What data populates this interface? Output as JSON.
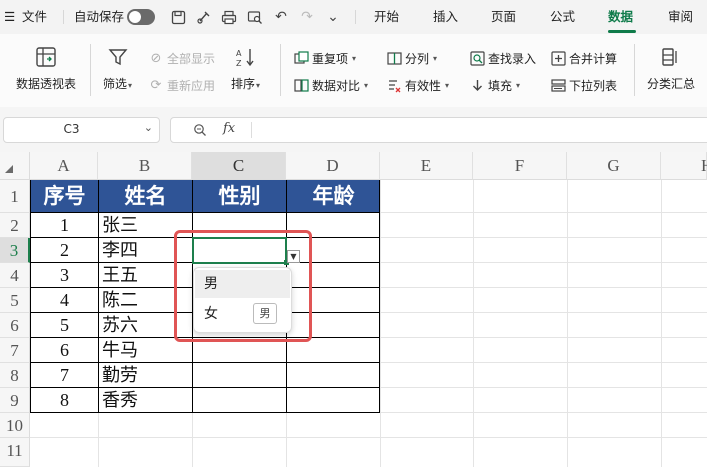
{
  "menubar": {
    "menu_icon": "hamburger-icon",
    "file_label": "文件",
    "autosave_label": "自动保存",
    "tabs": [
      {
        "label": "开始"
      },
      {
        "label": "插入"
      },
      {
        "label": "页面"
      },
      {
        "label": "公式"
      },
      {
        "label": "数据"
      },
      {
        "label": "审阅"
      }
    ],
    "active_tab": "数据",
    "accent_color": "#0f7b4a"
  },
  "ribbon": {
    "pivot_label": "数据透视表",
    "filter_label": "筛选",
    "show_all_label": "全部显示",
    "reapply_label": "重新应用",
    "sort_label": "排序",
    "duplicates_label": "重复项",
    "compare_label": "数据对比",
    "split_label": "分列",
    "validity_label": "有效性",
    "lookup_label": "查找录入",
    "fill_label": "填充",
    "consolidate_label": "合并计算",
    "dropdown_list_label": "下拉列表",
    "subtotal_label": "分类汇总"
  },
  "formula_bar": {
    "name_box": "C3",
    "fx_label": "fx",
    "formula": ""
  },
  "sheet": {
    "columns": [
      "A",
      "B",
      "C",
      "D",
      "E",
      "F",
      "G",
      "H"
    ],
    "rows": [
      "1",
      "2",
      "3",
      "4",
      "5",
      "6",
      "7",
      "8",
      "9",
      "10",
      "11"
    ],
    "selected_cell": "C3",
    "header_fill": "#2f5496",
    "table_headers": [
      "序号",
      "姓名",
      "性别",
      "年龄"
    ],
    "table_rows": [
      {
        "no": "1",
        "name": "张三"
      },
      {
        "no": "2",
        "name": "李四"
      },
      {
        "no": "3",
        "name": "王五"
      },
      {
        "no": "4",
        "name": "陈二"
      },
      {
        "no": "5",
        "name": "苏六"
      },
      {
        "no": "6",
        "name": "牛马"
      },
      {
        "no": "7",
        "name": "勤劳"
      },
      {
        "no": "8",
        "name": "香秀"
      }
    ]
  },
  "dropdown": {
    "options": [
      "男",
      "女"
    ],
    "hint_badge": "男",
    "highlight_color": "#e05555"
  }
}
